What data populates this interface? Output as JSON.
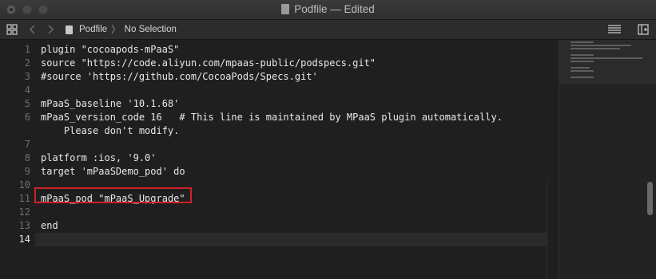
{
  "window": {
    "title": "Podfile — Edited"
  },
  "toolbar": {
    "breadcrumb_file": "Podfile",
    "breadcrumb_selection": "No Selection",
    "breadcrumb_separator": "〉"
  },
  "editor": {
    "lines": [
      {
        "num": "1",
        "text": "plugin \"cocoapods-mPaaS\""
      },
      {
        "num": "2",
        "text": "source \"https://code.aliyun.com/mpaas-public/podspecs.git\""
      },
      {
        "num": "3",
        "text": "#source 'https://github.com/CocoaPods/Specs.git'"
      },
      {
        "num": "4",
        "text": ""
      },
      {
        "num": "5",
        "text": "mPaaS_baseline '10.1.68'"
      },
      {
        "num": "6",
        "text": "mPaaS_version_code 16   # This line is maintained by MPaaS plugin automatically."
      },
      {
        "num": "",
        "text": "    Please don't modify."
      },
      {
        "num": "7",
        "text": ""
      },
      {
        "num": "8",
        "text": "platform :ios, '9.0'"
      },
      {
        "num": "9",
        "text": "target 'mPaaSDemo_pod' do"
      },
      {
        "num": "10",
        "text": ""
      },
      {
        "num": "11",
        "text": "mPaaS_pod \"mPaaS_Upgrade\""
      },
      {
        "num": "12",
        "text": ""
      },
      {
        "num": "13",
        "text": "end"
      },
      {
        "num": "14",
        "text": ""
      }
    ]
  },
  "colors": {
    "highlight_border": "#d0212a",
    "background": "#1f1f1f",
    "text": "#e8e8e8",
    "line_number": "#6f6f6f"
  }
}
